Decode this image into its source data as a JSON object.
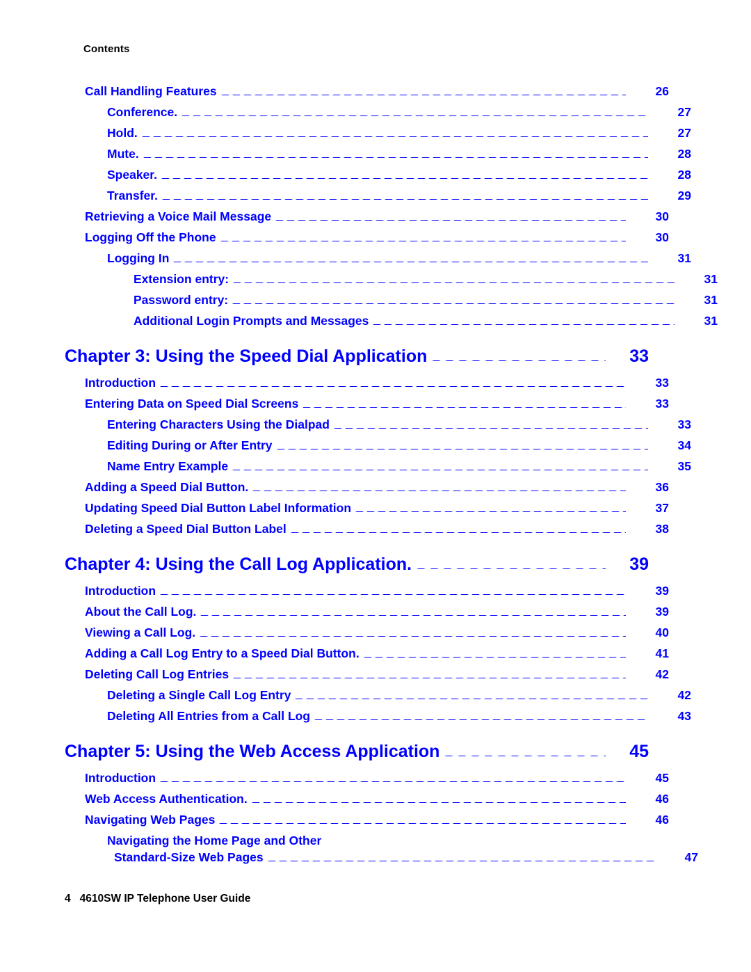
{
  "running_head": "Contents",
  "colors": {
    "link": "#0000ff",
    "text": "#000000",
    "background": "#ffffff"
  },
  "footer": {
    "page_number": "4",
    "document_title": "4610SW IP Telephone User Guide"
  },
  "toc": {
    "entries": [
      {
        "label": "Call Handling Features",
        "page": "26",
        "level": 1
      },
      {
        "label": "Conference.",
        "page": "27",
        "level": 2
      },
      {
        "label": "Hold.",
        "page": "27",
        "level": 2
      },
      {
        "label": "Mute.",
        "page": "28",
        "level": 2
      },
      {
        "label": "Speaker.",
        "page": "28",
        "level": 2
      },
      {
        "label": "Transfer.",
        "page": "29",
        "level": 2
      },
      {
        "label": "Retrieving a Voice Mail Message",
        "page": "30",
        "level": 1
      },
      {
        "label": "Logging Off the Phone",
        "page": "30",
        "level": 1
      },
      {
        "label": "Logging In",
        "page": "31",
        "level": 2
      },
      {
        "label": "Extension entry:",
        "page": "31",
        "level": 3
      },
      {
        "label": "Password entry:",
        "page": "31",
        "level": 3
      },
      {
        "label": "Additional Login Prompts and Messages",
        "page": "31",
        "level": 3
      },
      {
        "label": "Chapter 3: Using the Speed Dial Application",
        "page": "33",
        "level": 0
      },
      {
        "label": "Introduction",
        "page": "33",
        "level": 1
      },
      {
        "label": "Entering Data on Speed Dial Screens",
        "page": "33",
        "level": 1
      },
      {
        "label": "Entering Characters Using the Dialpad",
        "page": "33",
        "level": 2
      },
      {
        "label": "Editing During or After Entry",
        "page": "34",
        "level": 2
      },
      {
        "label": "Name Entry Example",
        "page": "35",
        "level": 2
      },
      {
        "label": "Adding a Speed Dial Button.",
        "page": "36",
        "level": 1
      },
      {
        "label": "Updating Speed Dial Button Label Information",
        "page": "37",
        "level": 1
      },
      {
        "label": "Deleting a Speed Dial Button Label",
        "page": "38",
        "level": 1
      },
      {
        "label": "Chapter 4: Using the Call Log Application.",
        "page": "39",
        "level": 0
      },
      {
        "label": "Introduction",
        "page": "39",
        "level": 1
      },
      {
        "label": "About the Call Log.",
        "page": "39",
        "level": 1
      },
      {
        "label": "Viewing a Call Log.",
        "page": "40",
        "level": 1
      },
      {
        "label": "Adding a Call Log Entry to a Speed Dial Button.",
        "page": "41",
        "level": 1
      },
      {
        "label": "Deleting Call Log Entries",
        "page": "42",
        "level": 1
      },
      {
        "label": "Deleting a Single Call Log Entry",
        "page": "42",
        "level": 2
      },
      {
        "label": "Deleting All Entries from a Call Log",
        "page": "43",
        "level": 2
      },
      {
        "label": "Chapter 5: Using the Web Access Application",
        "page": "45",
        "level": 0
      },
      {
        "label": "Introduction",
        "page": "45",
        "level": 1
      },
      {
        "label": "Web Access Authentication.",
        "page": "46",
        "level": 1
      },
      {
        "label": "Navigating Web Pages",
        "page": "46",
        "level": 1
      },
      {
        "label": "Navigating the Home Page and Other Standard-Size Web Pages",
        "line1": "Navigating the Home Page and Other",
        "line2": "Standard-Size Web Pages",
        "page": "47",
        "level": 2,
        "wrapped": true
      }
    ]
  }
}
